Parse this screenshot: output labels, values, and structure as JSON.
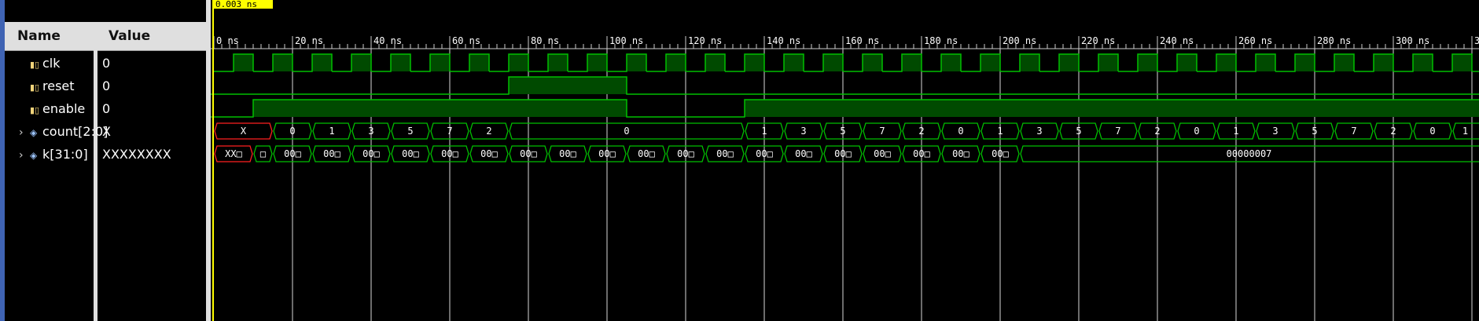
{
  "cursor": {
    "label": "0.003 ns"
  },
  "columns": {
    "name": "Name",
    "value": "Value"
  },
  "signals": [
    {
      "name": "clk",
      "value": "0",
      "type": "bit",
      "icon": "signal-icon"
    },
    {
      "name": "reset",
      "value": "0",
      "type": "bit",
      "icon": "signal-icon"
    },
    {
      "name": "enable",
      "value": "0",
      "type": "bit",
      "icon": "signal-icon"
    },
    {
      "name": "count[2:0]",
      "value": "X",
      "type": "bus",
      "icon": "bus-icon",
      "expand": "›"
    },
    {
      "name": "k[31:0]",
      "value": "XXXXXXXX",
      "type": "bus",
      "icon": "bus-icon",
      "expand": "›"
    }
  ],
  "timeline": {
    "labels": [
      "0 ns",
      "20 ns",
      "40 ns",
      "60 ns",
      "80 ns",
      "100 ns",
      "120 ns",
      "140 ns",
      "160 ns",
      "180 ns",
      "200 ns",
      "220 ns",
      "240 ns",
      "260 ns",
      "280 ns",
      "300 ns",
      "3"
    ]
  },
  "waves": {
    "clk_period_ns": 10,
    "clk_first_rise_ns": 5,
    "reset_high": [
      75,
      105
    ],
    "enable_low": [
      [
        0,
        10
      ],
      [
        105,
        135
      ]
    ],
    "count_segments": [
      {
        "from": 0,
        "to": 15,
        "label": "X",
        "error": true
      },
      {
        "from": 15,
        "to": 25,
        "label": "0"
      },
      {
        "from": 25,
        "to": 35,
        "label": "1"
      },
      {
        "from": 35,
        "to": 45,
        "label": "3"
      },
      {
        "from": 45,
        "to": 55,
        "label": "5"
      },
      {
        "from": 55,
        "to": 65,
        "label": "7"
      },
      {
        "from": 65,
        "to": 75,
        "label": "2"
      },
      {
        "from": 75,
        "to": 135,
        "label": "0"
      },
      {
        "from": 135,
        "to": 145,
        "label": "1"
      },
      {
        "from": 145,
        "to": 155,
        "label": "3"
      },
      {
        "from": 155,
        "to": 165,
        "label": "5"
      },
      {
        "from": 165,
        "to": 175,
        "label": "7"
      },
      {
        "from": 175,
        "to": 185,
        "label": "2"
      },
      {
        "from": 185,
        "to": 195,
        "label": "0"
      },
      {
        "from": 195,
        "to": 205,
        "label": "1"
      },
      {
        "from": 205,
        "to": 215,
        "label": "3"
      },
      {
        "from": 215,
        "to": 225,
        "label": "5"
      },
      {
        "from": 225,
        "to": 235,
        "label": "7"
      },
      {
        "from": 235,
        "to": 245,
        "label": "2"
      },
      {
        "from": 245,
        "to": 255,
        "label": "0"
      },
      {
        "from": 255,
        "to": 265,
        "label": "1"
      },
      {
        "from": 265,
        "to": 275,
        "label": "3"
      },
      {
        "from": 275,
        "to": 285,
        "label": "5"
      },
      {
        "from": 285,
        "to": 295,
        "label": "7"
      },
      {
        "from": 295,
        "to": 305,
        "label": "2"
      },
      {
        "from": 305,
        "to": 315,
        "label": "0"
      },
      {
        "from": 315,
        "to": 325,
        "label": "1"
      }
    ],
    "k_segments": [
      {
        "from": 0,
        "to": 10,
        "label": "XX□",
        "error": true
      },
      {
        "from": 10,
        "to": 15,
        "label": "□"
      },
      {
        "from": 15,
        "to": 25,
        "label": "00□"
      },
      {
        "from": 25,
        "to": 35,
        "label": "00□"
      },
      {
        "from": 35,
        "to": 45,
        "label": "00□"
      },
      {
        "from": 45,
        "to": 55,
        "label": "00□"
      },
      {
        "from": 55,
        "to": 65,
        "label": "00□"
      },
      {
        "from": 65,
        "to": 75,
        "label": "00□"
      },
      {
        "from": 75,
        "to": 85,
        "label": "00□"
      },
      {
        "from": 85,
        "to": 95,
        "label": "00□"
      },
      {
        "from": 95,
        "to": 105,
        "label": "00□"
      },
      {
        "from": 105,
        "to": 115,
        "label": "00□"
      },
      {
        "from": 115,
        "to": 125,
        "label": "00□"
      },
      {
        "from": 125,
        "to": 135,
        "label": "00□"
      },
      {
        "from": 135,
        "to": 145,
        "label": "00□"
      },
      {
        "from": 145,
        "to": 155,
        "label": "00□"
      },
      {
        "from": 155,
        "to": 165,
        "label": "00□"
      },
      {
        "from": 165,
        "to": 175,
        "label": "00□"
      },
      {
        "from": 175,
        "to": 185,
        "label": "00□"
      },
      {
        "from": 185,
        "to": 195,
        "label": "00□"
      },
      {
        "from": 195,
        "to": 205,
        "label": "00□"
      },
      {
        "from": 205,
        "to": 325,
        "label": "00000007"
      }
    ]
  },
  "colors": {
    "background": "#000000",
    "wave": "#00c000",
    "wave_fill": "#004a00",
    "error": "#ff2020",
    "cursor": "#ffff00",
    "grid": "#ffffff",
    "panel": "#dfdfdf",
    "panel_edge": "#3f63b3"
  }
}
